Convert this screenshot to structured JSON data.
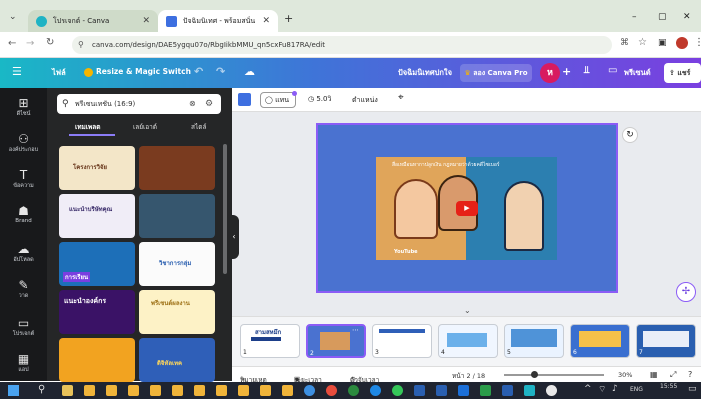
{
  "browser": {
    "tabs": [
      {
        "label": "โปรเจกต์ - Canva",
        "active": false
      },
      {
        "label": "ปัจฉิมนิเทศ - พร้อมสนั่น",
        "active": true
      }
    ],
    "new_tab": "+",
    "url": "canva.com/design/DAE5ygqu07o/RbgIikbMMU_qn5cxFu817RA/edit",
    "window_min": "–",
    "window_restore": "▢",
    "window_close": "✕"
  },
  "header": {
    "menu_icon": "☰",
    "file_label": "ไฟล์",
    "resize_label": "Resize & Magic Switch",
    "title": "ปัจฉิมนิเทศปกใจ",
    "trial_label": "ลอง Canva Pro",
    "avatar_letter": "ห",
    "share_label": "แชร์",
    "present_label": "พรีเซนต์"
  },
  "rail": [
    {
      "icon": "⊞",
      "label": "ดีไซน์"
    },
    {
      "icon": "⚇",
      "label": "องค์ประกอบ"
    },
    {
      "icon": "T",
      "label": "ข้อความ"
    },
    {
      "icon": "☗",
      "label": "Brand"
    },
    {
      "icon": "☁",
      "label": "อัปโหลด"
    },
    {
      "icon": "✎",
      "label": "วาด"
    },
    {
      "icon": "▭",
      "label": "โปรเจกต์"
    },
    {
      "icon": "▦",
      "label": "แอป"
    }
  ],
  "panel": {
    "search_value": "พรีเซนเทชัน (16:9)",
    "tabs": [
      "เทมเพลต",
      "เลย์เอาต์",
      "สไตล์"
    ],
    "thumbs": [
      {
        "text": "โครงการวิจัย"
      },
      {
        "text": ""
      },
      {
        "text": "แนะนำบริษัทคุณ"
      },
      {
        "text": ""
      },
      {
        "text": "การเรียน"
      },
      {
        "text": "วิชาการกลุ่ม"
      },
      {
        "text": "แนะนำองค์กร"
      },
      {
        "text": "พรีเซนต์ผลงาน"
      },
      {
        "text": ""
      },
      {
        "text": "ดิจิทัลเทค"
      }
    ]
  },
  "toolbar": {
    "effect_label": "แทน",
    "time_label": "5.0วิ",
    "position_label": "ตำแหน่ง"
  },
  "video": {
    "title": "สื่อเหมือนหากาปลูกเงิน กฎหมายว่าด้วยคดีไซเบอร์",
    "brand": "YouTube"
  },
  "pages": [
    {
      "num": "1",
      "label": "สามสหมึก"
    },
    {
      "num": "2",
      "label": ""
    },
    {
      "num": "3",
      "label": ""
    },
    {
      "num": "4",
      "label": ""
    },
    {
      "num": "5",
      "label": ""
    },
    {
      "num": "6",
      "label": ""
    },
    {
      "num": "7",
      "label": ""
    }
  ],
  "footer": {
    "notes_label": "หมายเหตุ",
    "timer_label": "ระยะเวลา",
    "timer2_label": "ตัวจับเวลา",
    "page_indicator": "หน้า 2 / 18",
    "zoom": "30%",
    "zoom_value": 0.3
  },
  "taskbar": {
    "time": "15:55",
    "lang": "ENG"
  },
  "colors": {
    "slide_bg": "#4a72d0",
    "selection": "#8b5cf6",
    "header_start": "#19b8c6",
    "header_end": "#7a3fe0"
  }
}
